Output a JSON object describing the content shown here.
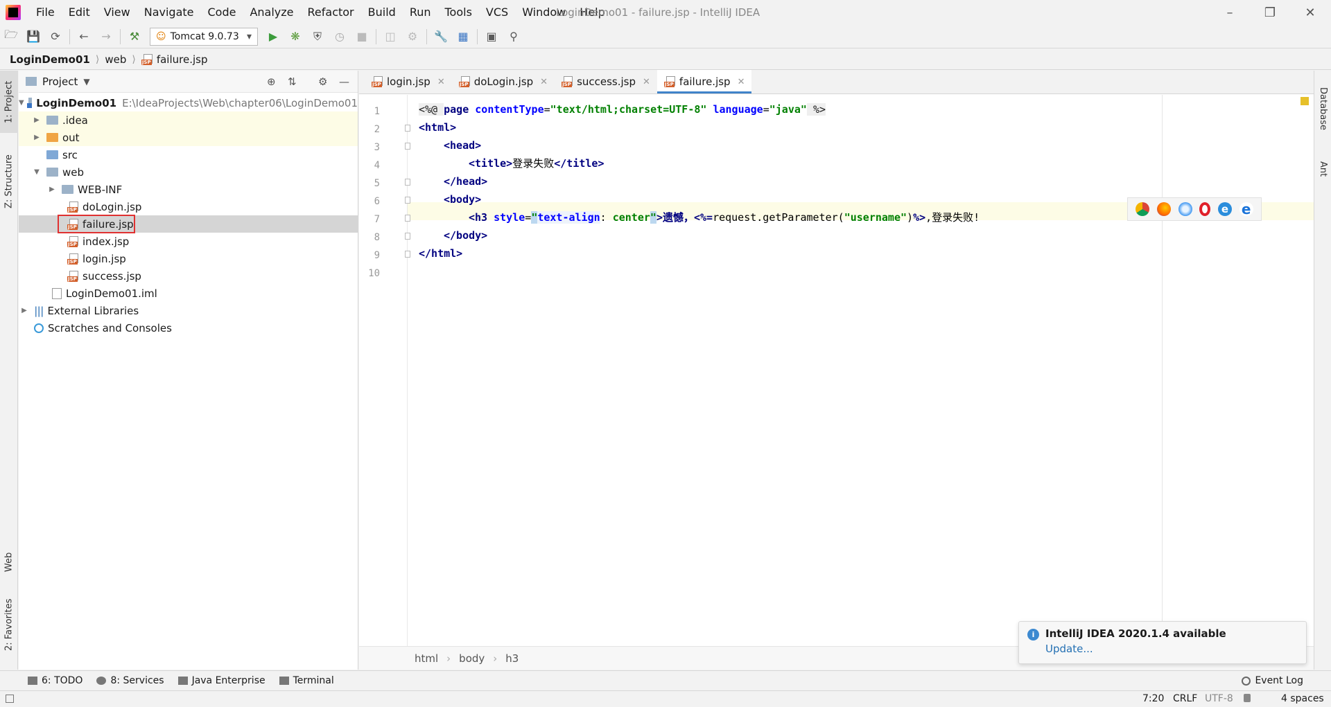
{
  "window": {
    "title": "LoginDemo01 - failure.jsp - IntelliJ IDEA",
    "menu": [
      "File",
      "Edit",
      "View",
      "Navigate",
      "Code",
      "Analyze",
      "Refactor",
      "Build",
      "Run",
      "Tools",
      "VCS",
      "Window",
      "Help"
    ]
  },
  "toolbar": {
    "run_config": "Tomcat 9.0.73"
  },
  "breadcrumbs": [
    "LoginDemo01",
    "web",
    "failure.jsp"
  ],
  "left_strip": {
    "project": "1: Project",
    "structure": "Z: Structure",
    "web": "Web",
    "favorites": "2: Favorites"
  },
  "right_strip": {
    "database": "Database",
    "ant": "Ant"
  },
  "project_panel": {
    "title": "Project",
    "tree": [
      {
        "label": "LoginDemo01",
        "path": "E:\\IdeaProjects\\Web\\chapter06\\LoginDemo01",
        "kind": "module"
      },
      {
        "label": ".idea",
        "kind": "folder"
      },
      {
        "label": "out",
        "kind": "folder-orange"
      },
      {
        "label": "src",
        "kind": "folder-blue"
      },
      {
        "label": "web",
        "kind": "folder-web"
      },
      {
        "label": "WEB-INF",
        "kind": "folder"
      },
      {
        "label": "doLogin.jsp",
        "kind": "jsp"
      },
      {
        "label": "failure.jsp",
        "kind": "jsp",
        "selected": true
      },
      {
        "label": "index.jsp",
        "kind": "jsp"
      },
      {
        "label": "login.jsp",
        "kind": "jsp"
      },
      {
        "label": "success.jsp",
        "kind": "jsp"
      },
      {
        "label": "LoginDemo01.iml",
        "kind": "iml"
      },
      {
        "label": "External Libraries",
        "kind": "libs"
      },
      {
        "label": "Scratches and Consoles",
        "kind": "scratch"
      }
    ]
  },
  "editor": {
    "tabs": [
      "login.jsp",
      "doLogin.jsp",
      "success.jsp",
      "failure.jsp"
    ],
    "active_tab": "failure.jsp",
    "line_numbers": [
      "1",
      "2",
      "3",
      "4",
      "5",
      "6",
      "7",
      "8",
      "9",
      "10"
    ],
    "code": {
      "l1": [
        "<%@ ",
        "page",
        " contentType",
        "=",
        "\"text/html;charset=UTF-8\"",
        " language",
        "=",
        "\"java\"",
        " %>"
      ],
      "l2": "<html>",
      "l3": "<head>",
      "l4": [
        "<title>",
        "登录失败",
        "</title>"
      ],
      "l5": "</head>",
      "l6": "<body>",
      "l7": [
        "<h3",
        " style",
        "=",
        "\"",
        "text-align",
        ": ",
        "center",
        "\"",
        ">遗憾，",
        "<%=",
        "request.getParameter(",
        "\"username\"",
        ")",
        "%>",
        ",登录失败!"
      ],
      "l8": "</body>",
      "l9": "</html>"
    },
    "crumbs": [
      "html",
      "body",
      "h3"
    ]
  },
  "notification": {
    "title": "IntelliJ IDEA 2020.1.4 available",
    "link": "Update..."
  },
  "bottom_tools": [
    "6: TODO",
    "8: Services",
    "Java Enterprise",
    "Terminal"
  ],
  "event_log": "Event Log",
  "status": {
    "position": "7:20",
    "line_sep": "CRLF",
    "encoding": "UTF-8",
    "indent": "4 spaces"
  },
  "colors": {
    "accent": "#4083c9",
    "tag": "#000080",
    "string": "#008000",
    "attr": "#0000ff",
    "selection_box": "#e03030"
  }
}
